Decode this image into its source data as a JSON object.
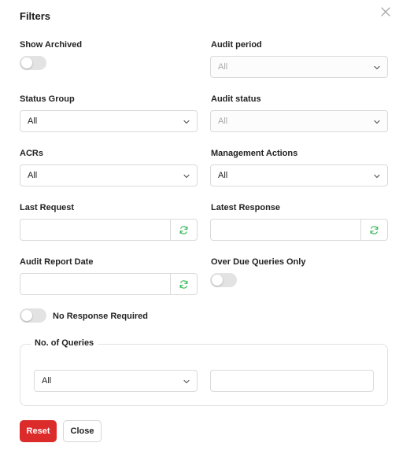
{
  "dialog": {
    "title": "Filters"
  },
  "fields": {
    "show_archived": {
      "label": "Show Archived",
      "on": false
    },
    "audit_period": {
      "label": "Audit period",
      "value": "All"
    },
    "status_group": {
      "label": "Status Group",
      "value": "All"
    },
    "audit_status": {
      "label": "Audit status",
      "value": "All"
    },
    "acrs": {
      "label": "ACRs",
      "value": "All"
    },
    "management_actions": {
      "label": "Management Actions",
      "value": "All"
    },
    "last_request": {
      "label": "Last Request",
      "value": ""
    },
    "latest_response": {
      "label": "Latest Response",
      "value": ""
    },
    "audit_report_date": {
      "label": "Audit Report Date",
      "value": ""
    },
    "over_due_queries_only": {
      "label": "Over Due Queries Only",
      "on": false
    },
    "no_response_required": {
      "label": "No Response Required",
      "on": false
    }
  },
  "queries": {
    "legend": "No. of Queries",
    "operator_value": "All",
    "count_value": ""
  },
  "buttons": {
    "reset": "Reset",
    "close": "Close"
  },
  "colors": {
    "accent_red": "#dc2b2b",
    "refresh_green": "#2bb24c"
  },
  "icons": {
    "close": "close-icon",
    "dropdown": "chevron-down-icon",
    "refresh": "refresh-icon"
  }
}
